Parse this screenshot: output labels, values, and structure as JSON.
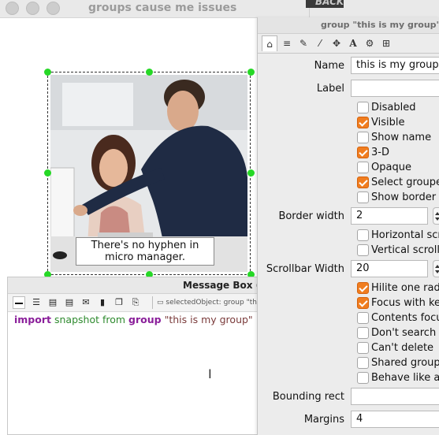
{
  "stack": {
    "title": "groups cause me issues",
    "caption_line1": "There's no hyphen in",
    "caption_line2": "micro manager."
  },
  "background_window": {
    "label": "BACKUP"
  },
  "message_box": {
    "title": "Message Box (S",
    "selected_object": "selectedObject: group \"this",
    "script": {
      "kw1": "import",
      "word1": "snapshot from",
      "kw2": "group",
      "str": "\"this is my group\""
    }
  },
  "inspector": {
    "title": "group \"this is my group\" (",
    "tabs": [
      "home-icon",
      "database-icon",
      "pencil-icon",
      "wand-icon",
      "move-icon",
      "text-icon",
      "gears-icon",
      "grid-icon"
    ],
    "name_label": "Name",
    "name_value": "this is my group",
    "label_label": "Label",
    "label_value": "",
    "checkboxes_a": [
      {
        "label": "Disabled",
        "checked": false
      },
      {
        "label": "Visible",
        "checked": true
      },
      {
        "label": "Show name",
        "checked": false
      },
      {
        "label": "3-D",
        "checked": true
      },
      {
        "label": "Opaque",
        "checked": false
      },
      {
        "label": "Select groupe",
        "checked": true
      },
      {
        "label": "Show border",
        "checked": false
      }
    ],
    "border_width_label": "Border width",
    "border_width_value": "2",
    "checkboxes_b": [
      {
        "label": "Horizontal scro",
        "checked": false
      },
      {
        "label": "Vertical scrollb",
        "checked": false
      }
    ],
    "scrollbar_width_label": "Scrollbar Width",
    "scrollbar_width_value": "20",
    "checkboxes_c": [
      {
        "label": "Hilite one radi",
        "checked": true
      },
      {
        "label": "Focus with ke",
        "checked": true
      },
      {
        "label": "Contents focu",
        "checked": false
      },
      {
        "label": "Don't search",
        "checked": false
      },
      {
        "label": "Can't delete",
        "checked": false
      },
      {
        "label": "Shared group",
        "checked": false
      },
      {
        "label": "Behave like a",
        "checked": false
      }
    ],
    "bounding_rect_label": "Bounding rect",
    "bounding_rect_value": "",
    "margins_label": "Margins",
    "margins_value": "4"
  },
  "colors": {
    "accent_checkbox": "#f07d1f",
    "selection_handle": "#26d826",
    "keyword": "#8a1e9a"
  }
}
